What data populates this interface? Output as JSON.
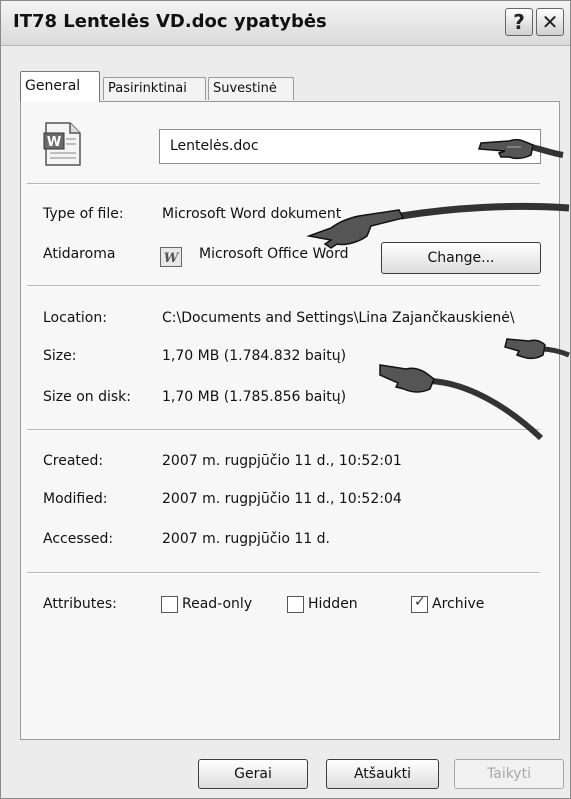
{
  "window": {
    "title": "IT78 Lentelės VD.doc ypatybės",
    "help_glyph": "?",
    "close_glyph": "✕"
  },
  "tabs": [
    {
      "label": "General",
      "active": true
    },
    {
      "label": "Pasirinktinai",
      "active": false
    },
    {
      "label": "Suvestinė",
      "active": false
    }
  ],
  "general": {
    "file_icon": "word-document-icon",
    "filename": "Lentelės.doc",
    "type_label": "Type of file:",
    "type_value": "Microsoft Word dokument",
    "opens_label": "Atidaroma",
    "opens_app_icon": "word-app-icon",
    "opens_value": "Microsoft Office Word",
    "change_button": "Change...",
    "location_label": "Location:",
    "location_value": "C:\\Documents and Settings\\Lina Zajančkauskienė\\",
    "size_label": "Size:",
    "size_value": "1,70 MB (1.784.832 baitų)",
    "size_disk_label": "Size on disk:",
    "size_disk_value": "1,70 MB (1.785.856 baitų)",
    "created_label": "Created:",
    "created_value": "2007 m. rugpjūčio 11 d., 10:52:01",
    "modified_label": "Modified:",
    "modified_value": "2007 m. rugpjūčio 11 d., 10:52:04",
    "accessed_label": "Accessed:",
    "accessed_value": "2007 m. rugpjūčio 11 d.",
    "attributes_label": "Attributes:",
    "attributes": [
      {
        "label": "Read-only",
        "checked": false
      },
      {
        "label": "Hidden",
        "checked": false
      },
      {
        "label": "Archive",
        "checked": true
      }
    ]
  },
  "buttons": {
    "ok": "Gerai",
    "cancel": "Atšaukti",
    "apply": "Taikyti",
    "apply_enabled": false
  },
  "annotations": {
    "pointer_icon": "pointing-hand-icon"
  }
}
